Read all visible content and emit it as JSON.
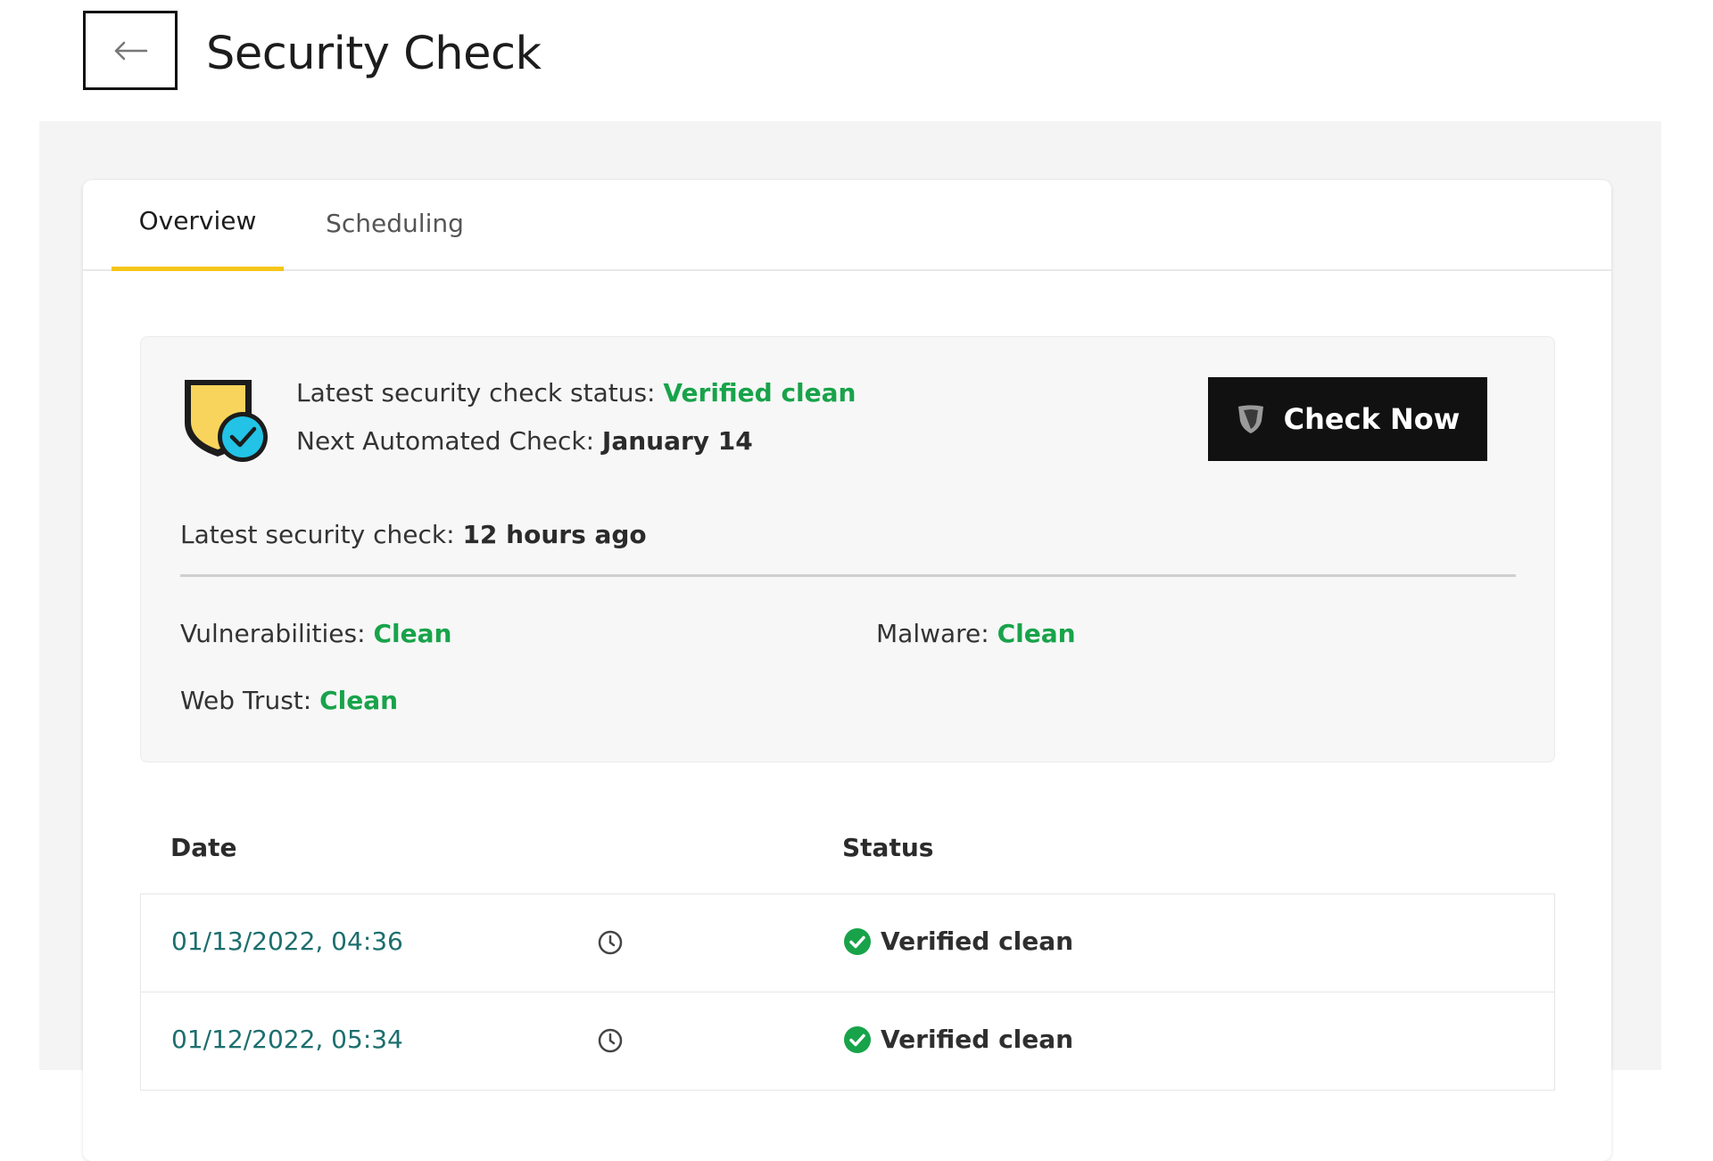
{
  "header": {
    "back_icon": "arrow-left-icon",
    "title": "Security Check"
  },
  "tabs": [
    {
      "label": "Overview",
      "active": true
    },
    {
      "label": "Scheduling",
      "active": false
    }
  ],
  "status_panel": {
    "badge_icon": "shield-check-icon",
    "latest_status_label": "Latest security check status: ",
    "latest_status_value": "Verified clean",
    "next_check_label": "Next Automated Check: ",
    "next_check_value": "January 14",
    "check_now_icon": "shield-icon",
    "check_now_label": "Check Now",
    "latest_check_label": "Latest security check: ",
    "latest_check_value": "12 hours ago",
    "results": {
      "vulnerabilities_label": "Vulnerabilities: ",
      "vulnerabilities_value": "Clean",
      "malware_label": "Malware: ",
      "malware_value": "Clean",
      "web_trust_label": "Web Trust: ",
      "web_trust_value": "Clean"
    }
  },
  "history": {
    "columns": [
      "Date",
      "Status"
    ],
    "rows": [
      {
        "date": "01/13/2022, 04:36",
        "status": "Verified clean",
        "clock_icon": "clock-icon",
        "status_icon": "check-circle-icon"
      },
      {
        "date": "01/12/2022, 05:34",
        "status": "Verified clean",
        "clock_icon": "clock-icon",
        "status_icon": "check-circle-icon"
      }
    ]
  },
  "colors": {
    "accent_yellow": "#f5c518",
    "clean_green": "#18a34a",
    "date_link_teal": "#1d6e6e",
    "button_black": "#111111",
    "badge_cyan": "#22c3e6",
    "shield_yellow": "#f9d45c"
  }
}
